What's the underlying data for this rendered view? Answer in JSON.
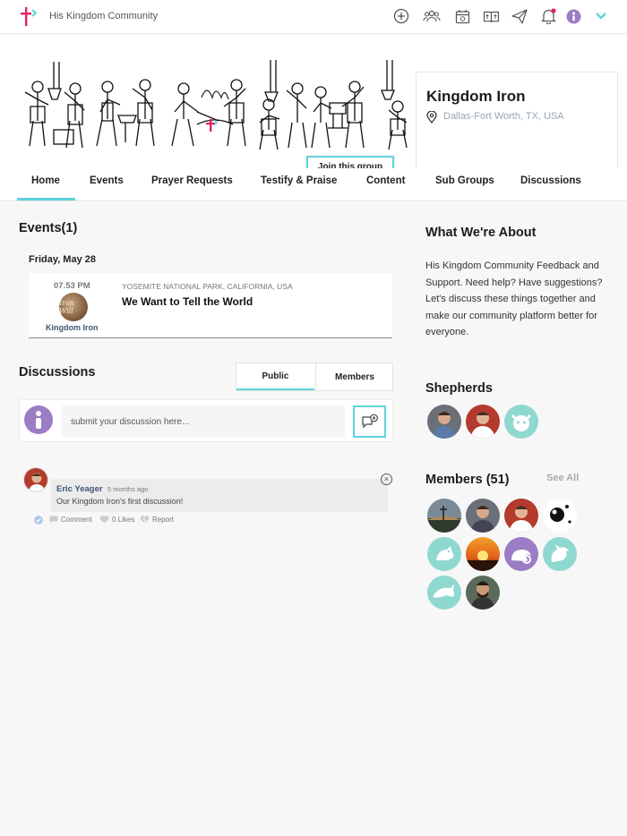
{
  "app": {
    "brand": "His Kingdom Community"
  },
  "colors": {
    "accent": "#5fd3dd",
    "purple": "#9c7cc4",
    "teal_avatar": "#8fd8d0",
    "notify": "#e0245e"
  },
  "top_icons": [
    "add-circle-icon",
    "groups-icon",
    "calendar-icon",
    "bible-icon",
    "send-icon",
    "bell-icon",
    "user-avatar-icon",
    "chevron-down-icon"
  ],
  "group": {
    "name": "Kingdom Iron",
    "location": "Dallas-Fort Worth, TX, USA",
    "join_label": "Join this group",
    "more_label": "•••"
  },
  "tabs": [
    {
      "label": "Home",
      "active": true
    },
    {
      "label": "Events"
    },
    {
      "label": "Prayer Requests"
    },
    {
      "label": "Testify & Praise"
    },
    {
      "label": "Content"
    },
    {
      "label": "Sub Groups"
    },
    {
      "label": "Discussions"
    }
  ],
  "events": {
    "heading": "Events(1)",
    "date": "Friday, May 28",
    "items": [
      {
        "time": "07.53 PM",
        "image_text": "Iron Will",
        "group": "Kingdom Iron",
        "location": "YOSEMITE NATIONAL PARK, CALIFORNIA, USA",
        "title": "We Want to Tell the World"
      }
    ]
  },
  "discussions": {
    "heading": "Discussions",
    "segments": [
      {
        "label": "Public",
        "active": true
      },
      {
        "label": "Members"
      }
    ],
    "placeholder": "submit your discussion here...",
    "posts": [
      {
        "author": "Eric Yeager",
        "time": "5 months ago",
        "text": "Our Kingdom Iron's first discussion!",
        "actions": {
          "comment": "Comment",
          "likes": "0 Likes",
          "report": "Report"
        }
      }
    ]
  },
  "about": {
    "heading": "What We're About",
    "text": "His Kingdom Community Feedback and Support. Need help? Have suggestions? Let's discuss these things together and make our community platform better for everyone."
  },
  "shepherds": {
    "heading": "Shepherds",
    "count": 3
  },
  "members": {
    "heading": "Members (51)",
    "see_all": "See All",
    "count": 11
  }
}
